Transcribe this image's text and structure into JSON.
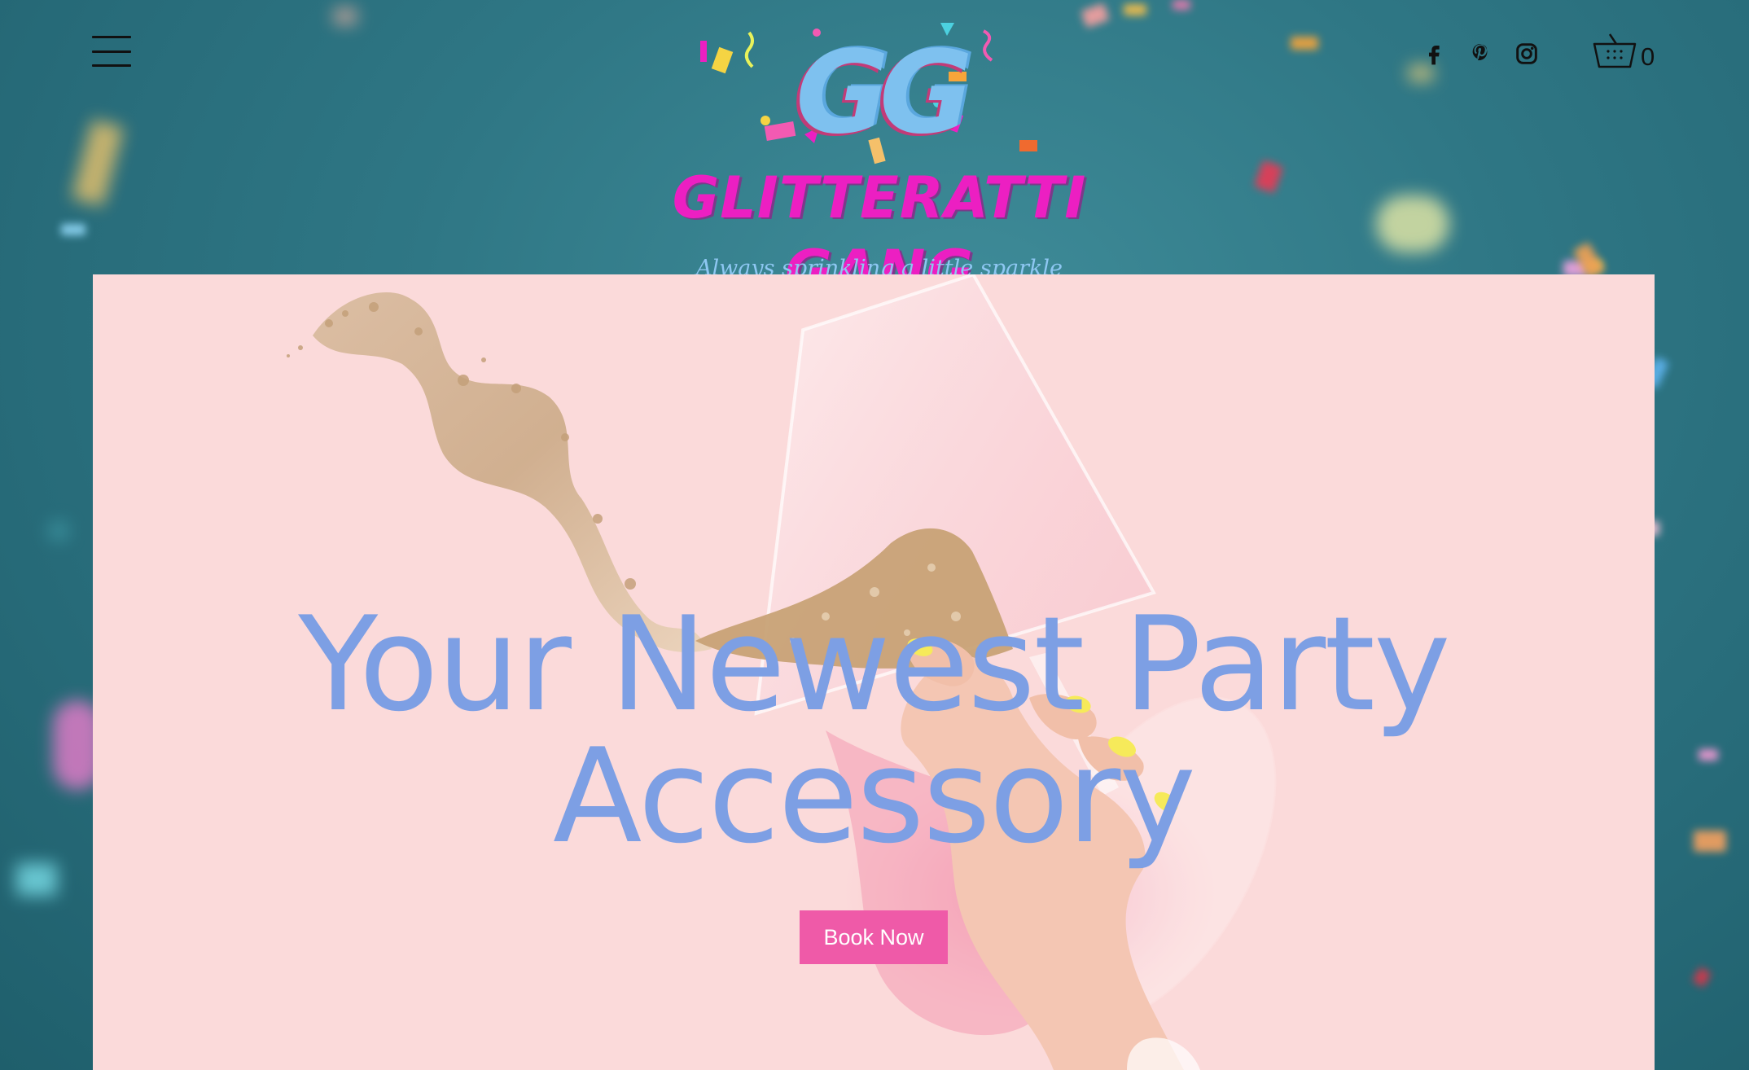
{
  "header": {
    "menu_icon": "hamburger-menu-icon",
    "logo": {
      "monogram": "GG",
      "name": "GLITTERATTI GANG",
      "tagline": "Always sprinkling a little sparkle"
    },
    "social": [
      {
        "name": "Facebook",
        "icon": "facebook-icon"
      },
      {
        "name": "Pinterest",
        "icon": "pinterest-icon"
      },
      {
        "name": "Instagram",
        "icon": "instagram-icon"
      }
    ],
    "cart": {
      "icon": "basket-icon",
      "count": "0"
    }
  },
  "hero": {
    "headline_line1": "Your Newest Party",
    "headline_line2": "Accessory",
    "cta_label": "Book Now"
  },
  "colors": {
    "background_teal": "#2f7785",
    "hero_pink": "#fbdada",
    "headline_blue": "#7d9fe4",
    "button_pink": "#ef5aa8",
    "logo_magenta": "#ec1fc2",
    "logo_blue": "#7ec1ef"
  }
}
